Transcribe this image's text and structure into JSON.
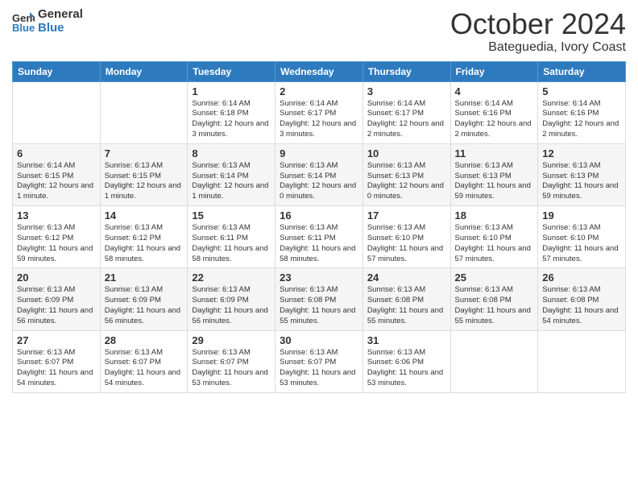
{
  "logo": {
    "line1": "General",
    "line2": "Blue"
  },
  "title": "October 2024",
  "location": "Bateguedia, Ivory Coast",
  "weekdays": [
    "Sunday",
    "Monday",
    "Tuesday",
    "Wednesday",
    "Thursday",
    "Friday",
    "Saturday"
  ],
  "weeks": [
    [
      {
        "day": "",
        "info": ""
      },
      {
        "day": "",
        "info": ""
      },
      {
        "day": "1",
        "info": "Sunrise: 6:14 AM\nSunset: 6:18 PM\nDaylight: 12 hours and 3 minutes."
      },
      {
        "day": "2",
        "info": "Sunrise: 6:14 AM\nSunset: 6:17 PM\nDaylight: 12 hours and 3 minutes."
      },
      {
        "day": "3",
        "info": "Sunrise: 6:14 AM\nSunset: 6:17 PM\nDaylight: 12 hours and 2 minutes."
      },
      {
        "day": "4",
        "info": "Sunrise: 6:14 AM\nSunset: 6:16 PM\nDaylight: 12 hours and 2 minutes."
      },
      {
        "day": "5",
        "info": "Sunrise: 6:14 AM\nSunset: 6:16 PM\nDaylight: 12 hours and 2 minutes."
      }
    ],
    [
      {
        "day": "6",
        "info": "Sunrise: 6:14 AM\nSunset: 6:15 PM\nDaylight: 12 hours and 1 minute."
      },
      {
        "day": "7",
        "info": "Sunrise: 6:13 AM\nSunset: 6:15 PM\nDaylight: 12 hours and 1 minute."
      },
      {
        "day": "8",
        "info": "Sunrise: 6:13 AM\nSunset: 6:14 PM\nDaylight: 12 hours and 1 minute."
      },
      {
        "day": "9",
        "info": "Sunrise: 6:13 AM\nSunset: 6:14 PM\nDaylight: 12 hours and 0 minutes."
      },
      {
        "day": "10",
        "info": "Sunrise: 6:13 AM\nSunset: 6:13 PM\nDaylight: 12 hours and 0 minutes."
      },
      {
        "day": "11",
        "info": "Sunrise: 6:13 AM\nSunset: 6:13 PM\nDaylight: 11 hours and 59 minutes."
      },
      {
        "day": "12",
        "info": "Sunrise: 6:13 AM\nSunset: 6:13 PM\nDaylight: 11 hours and 59 minutes."
      }
    ],
    [
      {
        "day": "13",
        "info": "Sunrise: 6:13 AM\nSunset: 6:12 PM\nDaylight: 11 hours and 59 minutes."
      },
      {
        "day": "14",
        "info": "Sunrise: 6:13 AM\nSunset: 6:12 PM\nDaylight: 11 hours and 58 minutes."
      },
      {
        "day": "15",
        "info": "Sunrise: 6:13 AM\nSunset: 6:11 PM\nDaylight: 11 hours and 58 minutes."
      },
      {
        "day": "16",
        "info": "Sunrise: 6:13 AM\nSunset: 6:11 PM\nDaylight: 11 hours and 58 minutes."
      },
      {
        "day": "17",
        "info": "Sunrise: 6:13 AM\nSunset: 6:10 PM\nDaylight: 11 hours and 57 minutes."
      },
      {
        "day": "18",
        "info": "Sunrise: 6:13 AM\nSunset: 6:10 PM\nDaylight: 11 hours and 57 minutes."
      },
      {
        "day": "19",
        "info": "Sunrise: 6:13 AM\nSunset: 6:10 PM\nDaylight: 11 hours and 57 minutes."
      }
    ],
    [
      {
        "day": "20",
        "info": "Sunrise: 6:13 AM\nSunset: 6:09 PM\nDaylight: 11 hours and 56 minutes."
      },
      {
        "day": "21",
        "info": "Sunrise: 6:13 AM\nSunset: 6:09 PM\nDaylight: 11 hours and 56 minutes."
      },
      {
        "day": "22",
        "info": "Sunrise: 6:13 AM\nSunset: 6:09 PM\nDaylight: 11 hours and 56 minutes."
      },
      {
        "day": "23",
        "info": "Sunrise: 6:13 AM\nSunset: 6:08 PM\nDaylight: 11 hours and 55 minutes."
      },
      {
        "day": "24",
        "info": "Sunrise: 6:13 AM\nSunset: 6:08 PM\nDaylight: 11 hours and 55 minutes."
      },
      {
        "day": "25",
        "info": "Sunrise: 6:13 AM\nSunset: 6:08 PM\nDaylight: 11 hours and 55 minutes."
      },
      {
        "day": "26",
        "info": "Sunrise: 6:13 AM\nSunset: 6:08 PM\nDaylight: 11 hours and 54 minutes."
      }
    ],
    [
      {
        "day": "27",
        "info": "Sunrise: 6:13 AM\nSunset: 6:07 PM\nDaylight: 11 hours and 54 minutes."
      },
      {
        "day": "28",
        "info": "Sunrise: 6:13 AM\nSunset: 6:07 PM\nDaylight: 11 hours and 54 minutes."
      },
      {
        "day": "29",
        "info": "Sunrise: 6:13 AM\nSunset: 6:07 PM\nDaylight: 11 hours and 53 minutes."
      },
      {
        "day": "30",
        "info": "Sunrise: 6:13 AM\nSunset: 6:07 PM\nDaylight: 11 hours and 53 minutes."
      },
      {
        "day": "31",
        "info": "Sunrise: 6:13 AM\nSunset: 6:06 PM\nDaylight: 11 hours and 53 minutes."
      },
      {
        "day": "",
        "info": ""
      },
      {
        "day": "",
        "info": ""
      }
    ]
  ]
}
